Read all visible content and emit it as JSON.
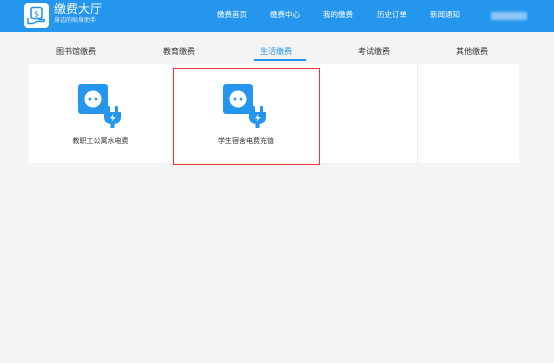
{
  "header": {
    "title": "缴费大厅",
    "subtitle": "身边的贴身助手",
    "nav": [
      "缴费首页",
      "缴费中心",
      "我的缴费",
      "历史订单",
      "新闻通知"
    ]
  },
  "tabs": [
    "图书馆缴费",
    "教育缴费",
    "生活缴费",
    "考试缴费",
    "其他缴费"
  ],
  "active_tab": "生活缴费",
  "cards": [
    {
      "label": "教职工公寓水电费",
      "icon": "power-plug-icon"
    },
    {
      "label": "学生宿舍电费充值",
      "icon": "power-plug-icon"
    }
  ],
  "colors": {
    "primary": "#2596ee",
    "highlight": "#e53935",
    "background": "#f4f4f4"
  }
}
